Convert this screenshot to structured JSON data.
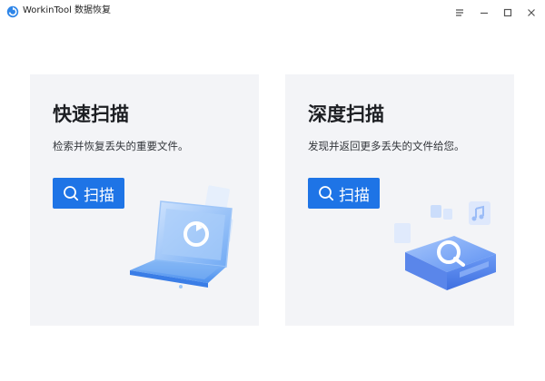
{
  "window": {
    "title": "WorkinTool 数据恢复",
    "controls": [
      "menu-icon",
      "minimize-icon",
      "maximize-icon",
      "close-icon"
    ]
  },
  "cards": [
    {
      "title": "快速扫描",
      "description": "检索并恢复丢失的重要文件。",
      "button_label": "扫描",
      "button_icon": "search-icon",
      "illustration": "laptop-icon"
    },
    {
      "title": "深度扫描",
      "description": "发现并返回更多丢失的文件给您。",
      "button_label": "扫描",
      "button_icon": "search-icon",
      "illustration": "disk-icon"
    }
  ],
  "colors": {
    "accent": "#1e74e6",
    "card_background": "#f3f4f7",
    "window_background": "#ffffff"
  }
}
